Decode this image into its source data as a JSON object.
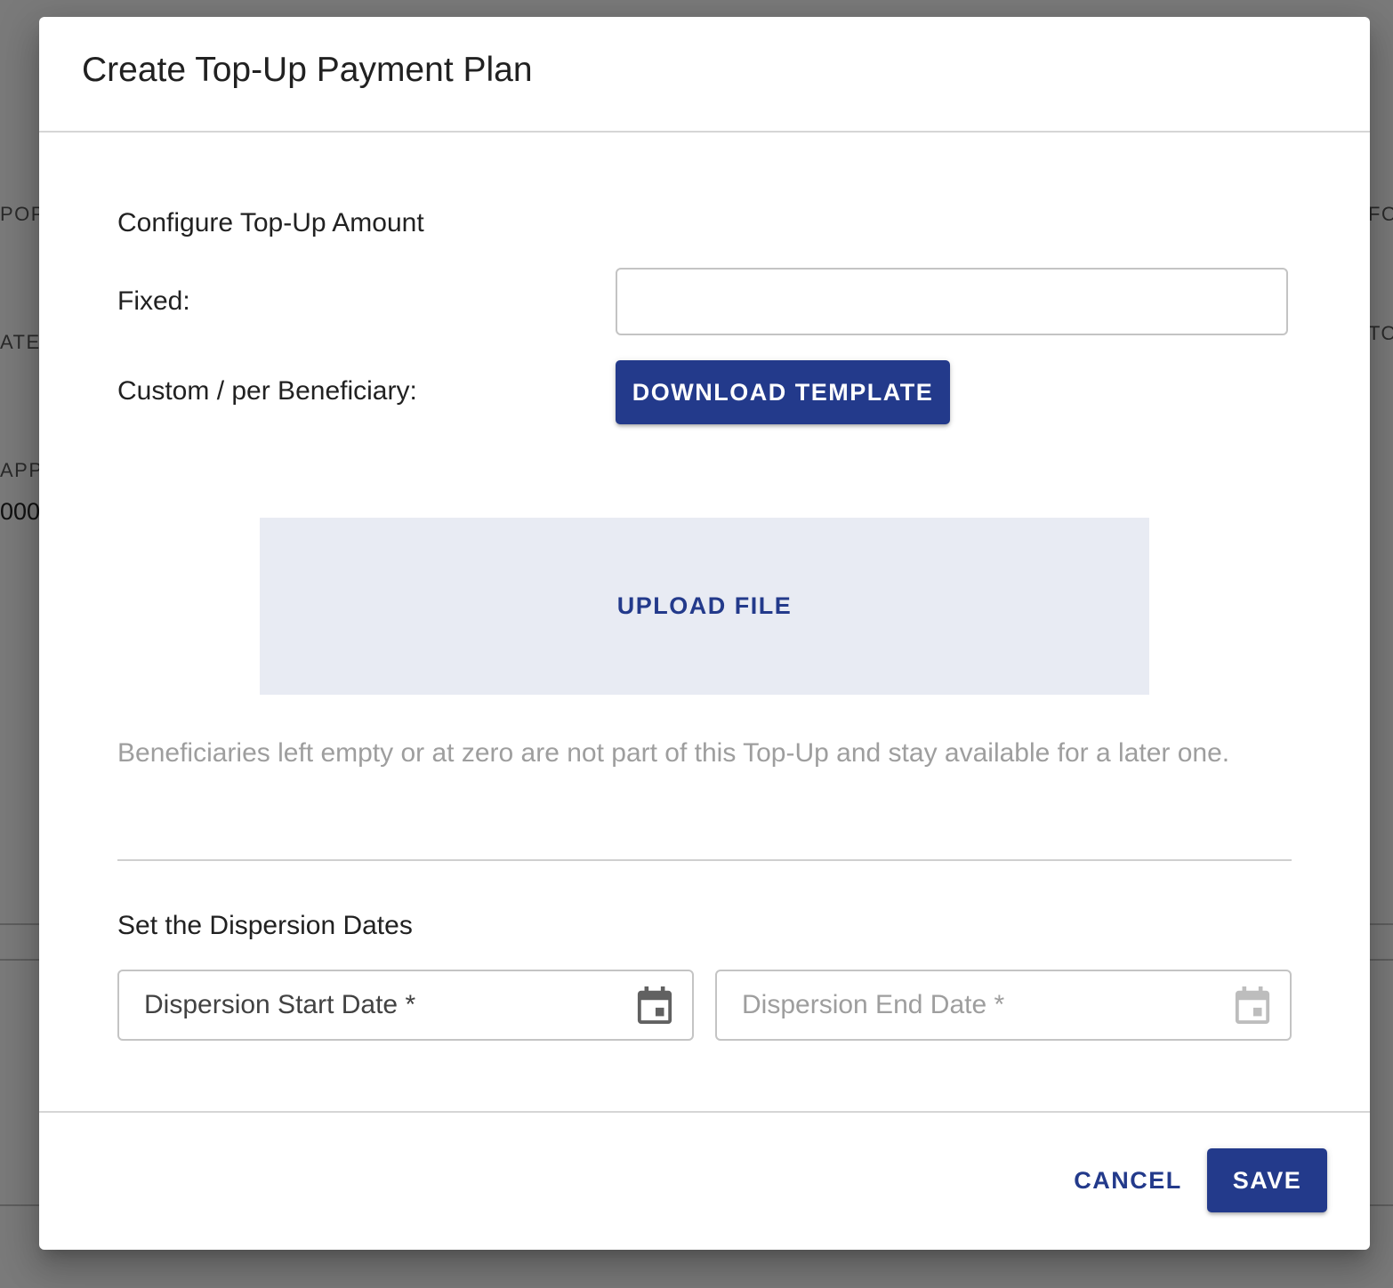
{
  "background": {
    "labels": [
      "POPU",
      "ATE",
      "APPL",
      "FO",
      "TO"
    ],
    "values": [
      "000"
    ]
  },
  "dialog": {
    "title": "Create Top-Up Payment Plan",
    "amount_section": {
      "title": "Configure Top-Up Amount",
      "fixed_label": "Fixed:",
      "fixed_value": "",
      "custom_label": "Custom / per Beneficiary:",
      "download_template_label": "DOWNLOAD TEMPLATE",
      "upload_label": "UPLOAD FILE",
      "helper_text": "Beneficiaries left empty or at zero are not part of this Top-Up and stay available for a later one."
    },
    "dates_section": {
      "title": "Set the Dispersion Dates",
      "start_date_placeholder": "Dispersion Start Date *",
      "end_date_placeholder": "Dispersion End Date *",
      "calendar_icon": "calendar-icon"
    },
    "footer": {
      "cancel_label": "CANCEL",
      "save_label": "SAVE"
    }
  },
  "colors": {
    "primary": "#233a8b",
    "upload_bg": "#e8ebf3",
    "placeholder_active": "#424242",
    "placeholder_disabled": "#9e9e9e",
    "helper_text": "#9e9e9e"
  }
}
